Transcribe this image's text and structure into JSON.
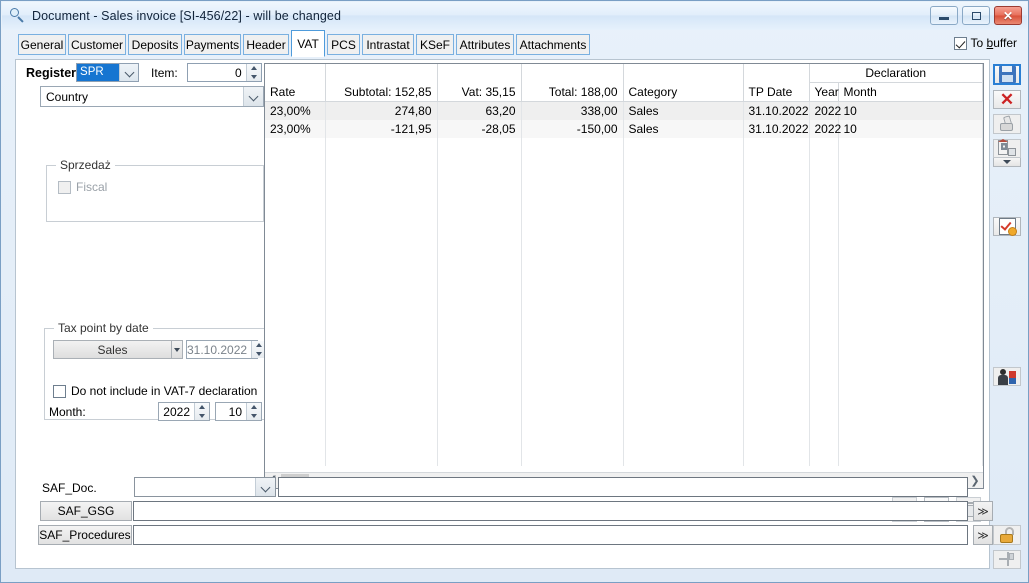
{
  "window": {
    "title": "Document - Sales invoice [SI-456/22]  - will be changed",
    "icon": "magnifier-document-icon",
    "buttons": {
      "minimize": "minimize-icon",
      "maximize": "maximize-icon",
      "close": "close-icon"
    }
  },
  "tabs": [
    {
      "label": "General",
      "active": false
    },
    {
      "label": "Customer",
      "active": false
    },
    {
      "label": "Deposits",
      "active": false
    },
    {
      "label": "Payments",
      "active": false
    },
    {
      "label": "Header",
      "active": false
    },
    {
      "label": "VAT",
      "active": true
    },
    {
      "label": "PCS",
      "active": false
    },
    {
      "label": "Intrastat",
      "active": false
    },
    {
      "label": "KSeF",
      "active": false
    },
    {
      "label": "Attributes",
      "active": false
    },
    {
      "label": "Attachments",
      "active": false
    }
  ],
  "to_buffer": {
    "label_pre": "To ",
    "label_accel": "b",
    "label_post": "uffer",
    "checked": true
  },
  "form": {
    "register_label": "Register",
    "register_value": "SPR",
    "item_label": "Item:",
    "item_value": "0",
    "country_value": "Country",
    "sprzedaz_group": "Sprzedaż",
    "fiscal_label": "Fiscal",
    "fiscal_checked": false
  },
  "taxpoint": {
    "group_label": "Tax point by date",
    "type_value": "Sales",
    "date_value": "31.10.2022",
    "exclude_label": "Do not include in VAT-7 declaration",
    "exclude_checked": false,
    "month_label": "Month:",
    "year_value": "2022",
    "month_value": "10"
  },
  "grid": {
    "headers": {
      "rate": "Rate",
      "subtotal": "Subtotal: 152,85",
      "vat": "Vat: 35,15",
      "total": "Total: 188,00",
      "category": "Category",
      "tp_date": "TP Date",
      "declaration": "Declaration",
      "year": "Year",
      "month": "Month"
    },
    "rows": [
      {
        "rate": "23,00%",
        "subtotal": "274,80",
        "vat": "63,20",
        "total": "338,00",
        "category": "Sales",
        "tp_date": "31.10.2022",
        "year": "2022",
        "month": "10"
      },
      {
        "rate": "23,00%",
        "subtotal": "-121,95",
        "vat": "-28,05",
        "total": "-150,00",
        "category": "Sales",
        "tp_date": "31.10.2022",
        "year": "2022",
        "month": "10"
      }
    ],
    "scroll": {
      "left_arrow": "❮",
      "right_arrow": "❯"
    },
    "actions": [
      {
        "name": "add-row-button",
        "icon": "plus-icon"
      },
      {
        "name": "find-row-button",
        "icon": "magnifier-icon"
      },
      {
        "name": "delete-row-button",
        "icon": "trash-icon"
      }
    ]
  },
  "saf": {
    "doc_label": "SAF_Doc.",
    "doc_combo_value": "",
    "doc_field_value": "",
    "gsg_label": "SAF_GSG",
    "gsg_value": "",
    "procedures_label": "SAF_Procedures",
    "procedures_value": "",
    "more_label": "≫"
  },
  "toolbar": [
    {
      "name": "save-button",
      "icon": "floppy-save-icon",
      "selected": true
    },
    {
      "name": "cancel-button",
      "icon": "red-x-icon",
      "selected": false
    },
    {
      "name": "print-button",
      "icon": "hand-stamp-icon",
      "selected": false
    },
    {
      "name": "company-button",
      "icon": "building-icon",
      "selected": false
    },
    {
      "name": "company-dropdown",
      "icon": "chevron-down-icon",
      "selected": false
    },
    {
      "name": "verify-button",
      "icon": "checklist-gear-icon",
      "selected": false
    },
    {
      "name": "user-button",
      "icon": "user-flags-icon",
      "selected": false
    },
    {
      "name": "unlock-button",
      "icon": "padlock-open-icon",
      "selected": false
    },
    {
      "name": "pin-button",
      "icon": "pin-icon",
      "selected": false
    }
  ],
  "colors": {
    "accent": "#1675d1",
    "tab_border": "#7ab0e0",
    "active_tab_border": "#4e9bdb",
    "close_button": "#d9503a",
    "row_alt": "#efefef"
  }
}
